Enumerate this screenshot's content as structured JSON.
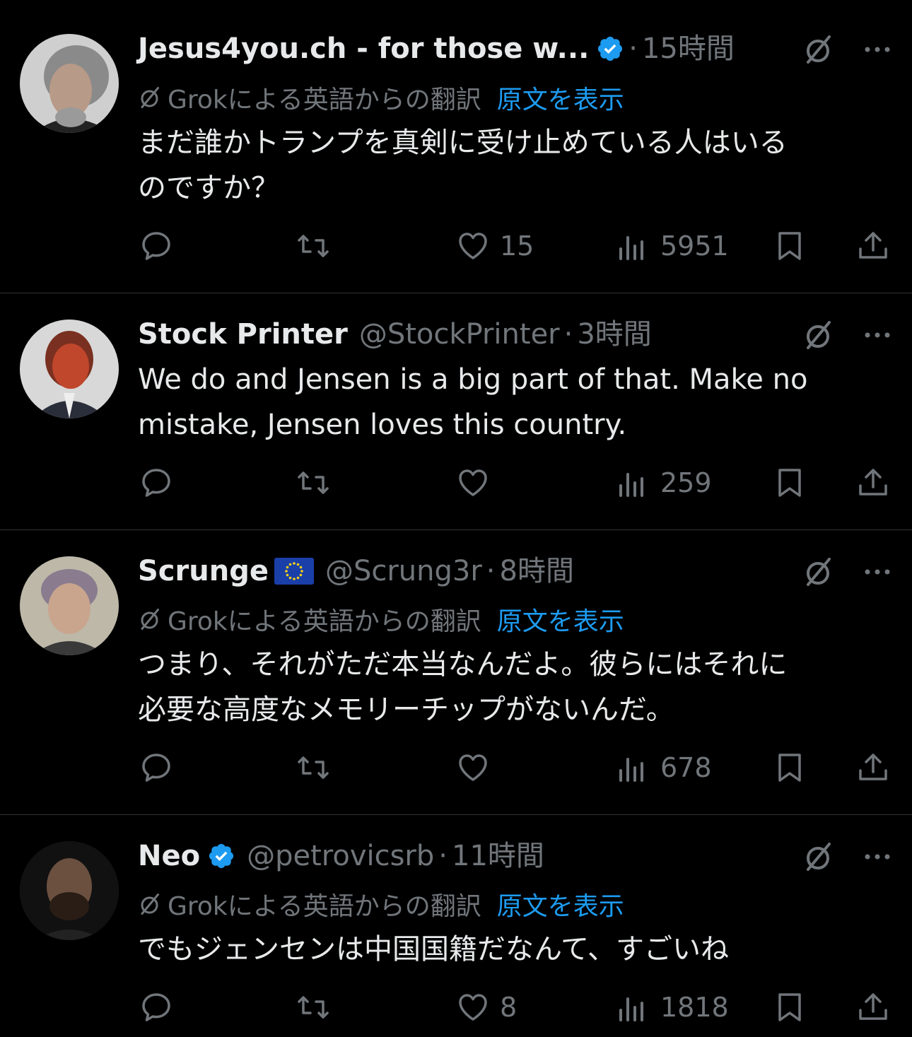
{
  "posts": [
    {
      "name": "Jesus4you.ch - for those w...",
      "handle": "",
      "dot": "·",
      "time": "15時間",
      "verified": true,
      "flag": false,
      "translation": {
        "label": "Grokによる英語からの翻訳",
        "show_original": "原文を表示"
      },
      "text": "まだ誰かトランプを真剣に受け止めている人はいる\nのですか？",
      "replies": "",
      "reposts": "",
      "likes": "15",
      "views": "5951"
    },
    {
      "name": "Stock Printer",
      "handle": "@StockPrinter",
      "dot": "·",
      "time": "3時間",
      "verified": false,
      "flag": false,
      "translation": null,
      "text": "We do and Jensen is a big part of that. Make no\nmistake, Jensen loves this country.",
      "replies": "",
      "reposts": "",
      "likes": "",
      "views": "259"
    },
    {
      "name": "Scrunge",
      "handle": "@Scrung3r",
      "dot": "·",
      "time": "8時間",
      "verified": false,
      "flag": true,
      "translation": {
        "label": "Grokによる英語からの翻訳",
        "show_original": "原文を表示"
      },
      "text": "つまり、それがただ本当なんだよ。彼らにはそれに\n必要な高度なメモリーチップがないんだ。",
      "replies": "",
      "reposts": "",
      "likes": "",
      "views": "678"
    },
    {
      "name": "Neo",
      "handle": "@petrovicsrb",
      "dot": "·",
      "time": "11時間",
      "verified": true,
      "flag": false,
      "translation": {
        "label": "Grokによる英語からの翻訳",
        "show_original": "原文を表示"
      },
      "text": "でもジェンセンは中国国籍だなんて、すごいね",
      "replies": "",
      "reposts": "",
      "likes": "8",
      "views": "1818"
    }
  ],
  "icons": {
    "reply": "reply-icon",
    "repost": "repost-icon",
    "like": "like-icon",
    "views": "views-icon",
    "bookmark": "bookmark-icon",
    "share": "share-icon",
    "more": "more-icon",
    "grok_off": "grok-translate-off-icon"
  },
  "colors": {
    "background": "#000000",
    "text": "#e7e9ea",
    "muted": "#71767b",
    "link": "#1d9bf0",
    "verified": "#1d9bf0"
  }
}
